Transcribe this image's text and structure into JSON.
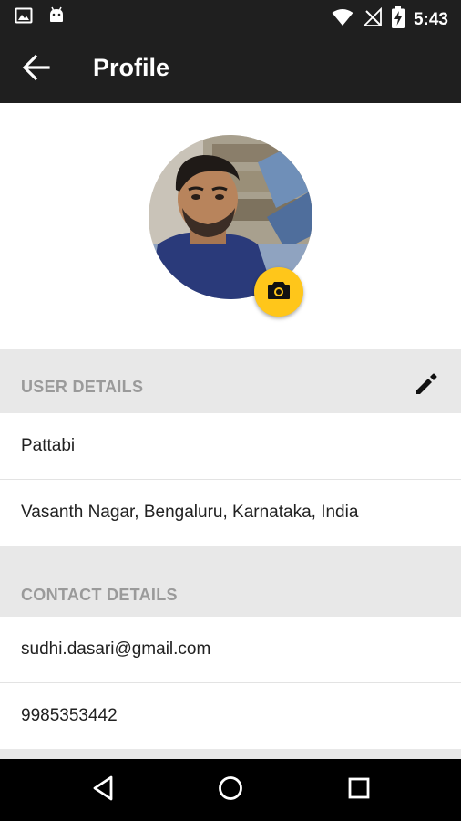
{
  "status_bar": {
    "time": "5:43",
    "left_icons": [
      "image-icon",
      "android-icon"
    ],
    "right_icons": [
      "wifi-icon",
      "no-signal-icon",
      "battery-charging-icon"
    ]
  },
  "app_bar": {
    "title": "Profile",
    "back_icon": "arrow-back-icon",
    "background": "#1f1f1f"
  },
  "profile": {
    "camera_icon": "camera-icon",
    "accent_color": "#ffc61a"
  },
  "user_details": {
    "header": "USER DETAILS",
    "edit_icon": "pencil-icon",
    "name": "Pattabi",
    "address": "Vasanth Nagar, Bengaluru, Karnataka, India"
  },
  "contact_details": {
    "header": "CONTACT DETAILS",
    "email": "sudhi.dasari@gmail.com",
    "phone": "9985353442"
  },
  "nav_bar": {
    "icons": [
      "back-triangle-icon",
      "home-circle-icon",
      "recents-square-icon"
    ]
  }
}
